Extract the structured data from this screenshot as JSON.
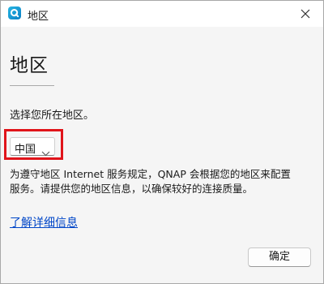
{
  "window": {
    "title": "地区",
    "app_icon": "qnap-q-icon",
    "close_icon": "close-icon"
  },
  "main": {
    "heading": "地区",
    "prompt": "选择您所在地区。",
    "region_select": {
      "selected": "中国",
      "icon": "chevron-down-icon"
    },
    "description_lines": [
      "为遵守地区 Internet 服务规定，QNAP 会根据您的地区来配置",
      "服务。请提供您的地区信息，以确保较好的连接质量。"
    ],
    "learn_more": "了解详细信息",
    "ok_button": "确定"
  },
  "colors": {
    "highlight": "#e0141a",
    "link": "#0046c8",
    "background": "#f5f5f5"
  }
}
